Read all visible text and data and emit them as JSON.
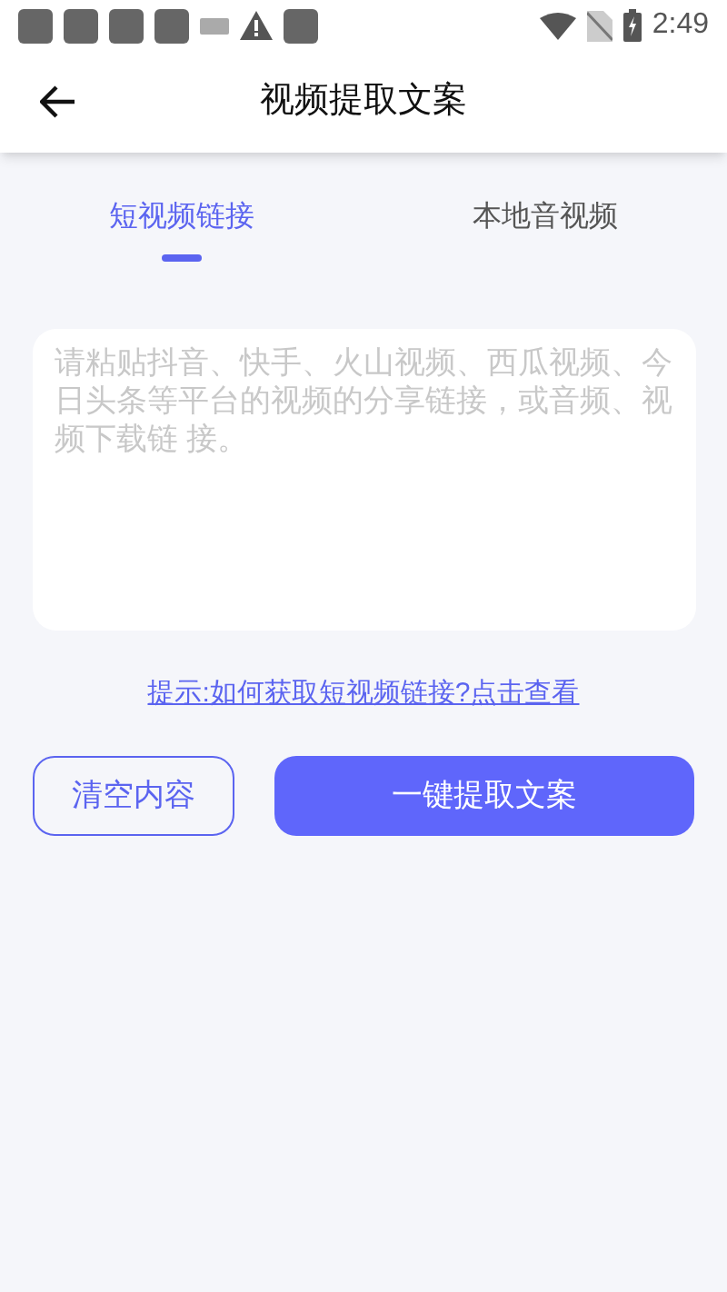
{
  "status_bar": {
    "time": "2:49"
  },
  "app_bar": {
    "title": "视频提取文案"
  },
  "tabs": [
    {
      "label": "短视频链接",
      "selected": true
    },
    {
      "label": "本地音视频",
      "selected": false
    }
  ],
  "input": {
    "placeholder": "请粘贴抖音、快手、火山视频、西瓜视频、今日头条等平台的视频的分享链接，或音频、视频下载链 接。"
  },
  "hint_link": "提示:如何获取短视频链接?点击查看",
  "buttons": [
    {
      "label": "清空内容",
      "kind": "outline"
    },
    {
      "label": "一键提取文案",
      "kind": "filled"
    }
  ]
}
